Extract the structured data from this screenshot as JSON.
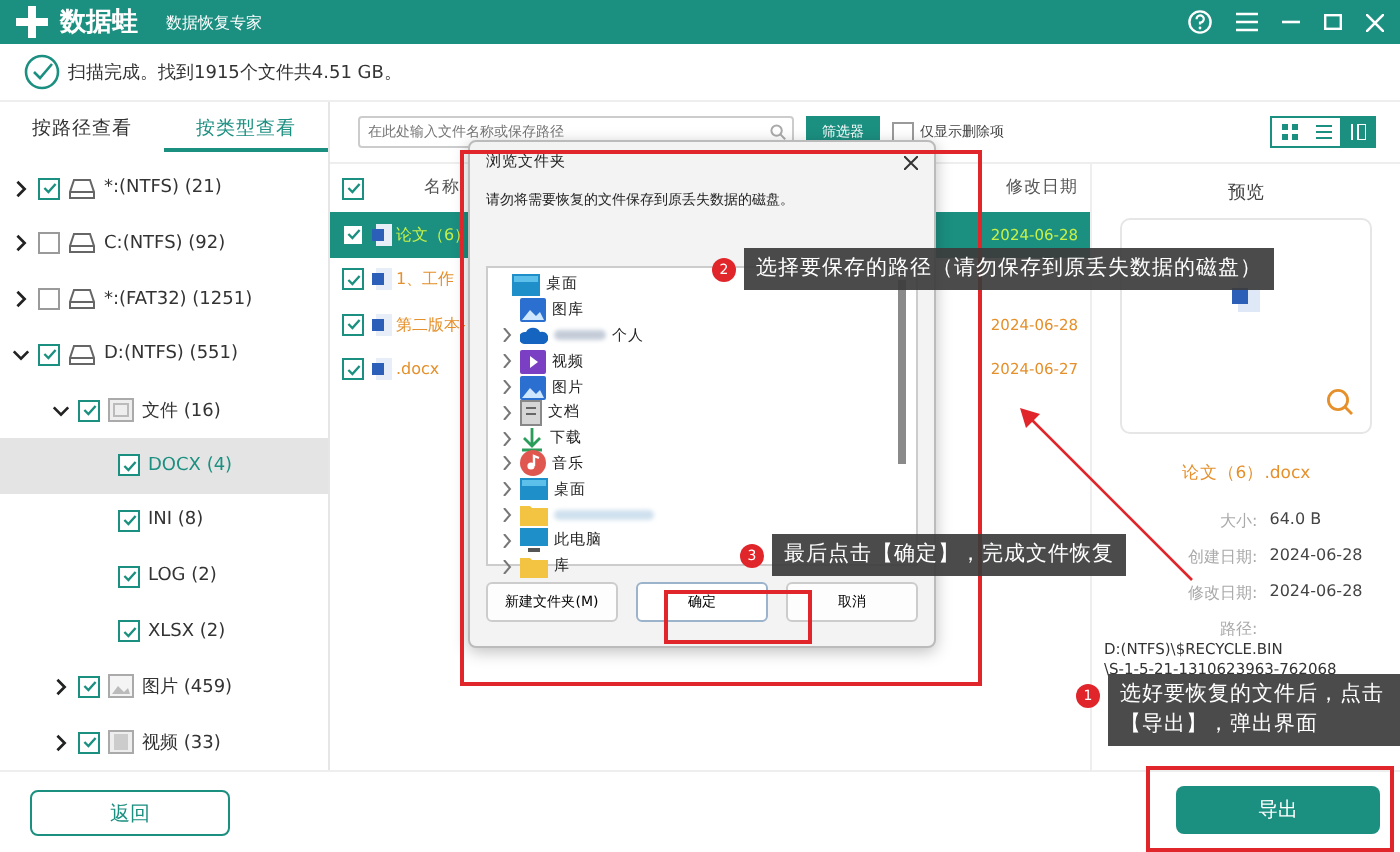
{
  "header": {
    "app_name": "数据蛙",
    "subtitle": "数据恢复专家"
  },
  "status": {
    "text": "扫描完成。找到1915个文件共4.51 GB。"
  },
  "left_tabs": [
    {
      "label": "按路径查看",
      "selected": false
    },
    {
      "label": "按类型查看",
      "selected": true
    }
  ],
  "tree": [
    {
      "label": "*:(NTFS) (21)",
      "kind": "drive",
      "checked": true,
      "expanded": false,
      "selected": false
    },
    {
      "label": "C:(NTFS) (92)",
      "kind": "drive",
      "checked": false,
      "expanded": false,
      "selected": false
    },
    {
      "label": "*:(FAT32) (1251)",
      "kind": "drive",
      "checked": false,
      "expanded": false,
      "selected": false
    },
    {
      "label": "D:(NTFS) (551)",
      "kind": "drive",
      "checked": true,
      "expanded": true,
      "selected": false,
      "children": [
        {
          "label": "文件 (16)",
          "kind": "document",
          "checked": true,
          "expanded": true,
          "selected": false,
          "children": [
            {
              "label": "DOCX (4)",
              "checked": true,
              "selected": true
            },
            {
              "label": "INI (8)",
              "checked": true,
              "selected": false
            },
            {
              "label": "LOG (2)",
              "checked": true,
              "selected": false
            },
            {
              "label": "XLSX (2)",
              "checked": true,
              "selected": false
            }
          ]
        },
        {
          "label": "图片 (459)",
          "kind": "image",
          "checked": true,
          "expanded": false,
          "selected": false
        },
        {
          "label": "视频 (33)",
          "kind": "video",
          "checked": true,
          "expanded": false,
          "selected": false
        }
      ]
    }
  ],
  "toolbar": {
    "search": {
      "placeholder": "在此处输入文件名称或保存路径"
    },
    "filter_button": "筛选器",
    "deleted_only": {
      "label": "仅显示删除项",
      "checked": false
    },
    "views": [
      {
        "kind": "grid",
        "selected": false
      },
      {
        "kind": "list",
        "selected": false
      },
      {
        "kind": "columns",
        "selected": true
      }
    ]
  },
  "file_list": {
    "all_checked": true,
    "columns": [
      "名称",
      "修改日期"
    ],
    "rows": [
      {
        "name": "论文（6）",
        "date": "2024-06-28",
        "checked": true,
        "selected": true
      },
      {
        "name": "1、工作",
        "checked": true,
        "selected": false
      },
      {
        "name": "第二版本-",
        "date": "2024-06-28",
        "checked": true,
        "selected": false
      },
      {
        "name": ".docx",
        "date": "2024-06-27",
        "checked": true,
        "selected": false
      }
    ]
  },
  "preview": {
    "title": "预览",
    "file_name": "论文（6）.docx",
    "fields": [
      {
        "label": "大小:",
        "value": "64.0  B"
      },
      {
        "label": "创建日期:",
        "value": "2024-06-28"
      },
      {
        "label": "修改日期:",
        "value": "2024-06-28"
      }
    ],
    "path_label": "路径:",
    "path": [
      "D:(NTFS)\\$RECYCLE.BIN",
      "\\S-1-5-21-1310623963-762068"
    ]
  },
  "footer": {
    "back_button": "返回",
    "export_button": "导出"
  },
  "dialog": {
    "title": "浏览文件夹",
    "message": "请勿将需要恢复的文件保存到原丢失数据的磁盘。",
    "folders": [
      {
        "label": "桌面",
        "kind": "desktop",
        "children": [
          {
            "label": "图库",
            "kind": "gallery"
          },
          {
            "label": "个人",
            "kind": "cloud",
            "expanded": false
          },
          {
            "label": "视频",
            "kind": "video",
            "expanded": false
          },
          {
            "label": "图片",
            "kind": "gallery",
            "expanded": false
          },
          {
            "label": "文档",
            "kind": "document",
            "expanded": false
          },
          {
            "label": "下载",
            "kind": "download",
            "expanded": false
          },
          {
            "label": "音乐",
            "kind": "music",
            "expanded": false
          },
          {
            "label": "桌面",
            "kind": "desktop",
            "expanded": false
          },
          {
            "kind": "blurred",
            "expanded": false
          },
          {
            "label": "此电脑",
            "kind": "pc",
            "expanded": false
          },
          {
            "label": "库",
            "kind": "folder",
            "expanded": false
          }
        ]
      }
    ],
    "buttons": [
      {
        "label": "新建文件夹(M)",
        "kind": "secondary"
      },
      {
        "label": "确定",
        "kind": "primary"
      },
      {
        "label": "取消",
        "kind": "secondary"
      }
    ]
  },
  "callouts": [
    {
      "number": "2",
      "text": "选择要保存的路径（请勿保存到原丢失数据的磁盘）"
    },
    {
      "number": "3",
      "text": "最后点击【确定】，完成文件恢复"
    },
    {
      "number": "1",
      "text": "选好要恢复的文件后，点击【导出】，弹出界面"
    }
  ]
}
